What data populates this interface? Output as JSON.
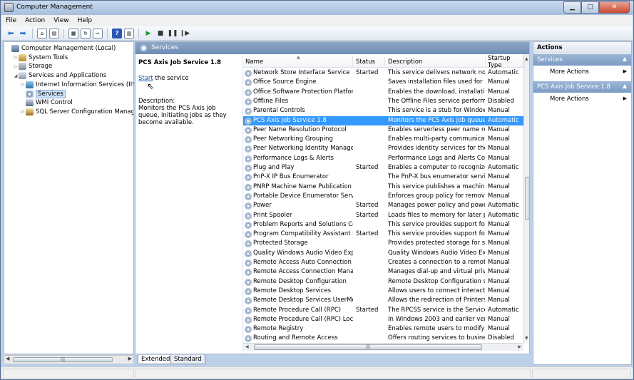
{
  "window": {
    "title": "Computer Management"
  },
  "menu": [
    "File",
    "Action",
    "View",
    "Help"
  ],
  "tree": [
    {
      "label": "Computer Management (Local)",
      "icon": "computer-icon",
      "level": 0,
      "expander": ""
    },
    {
      "label": "System Tools",
      "icon": "tools-icon",
      "level": 1,
      "expander": "▷"
    },
    {
      "label": "Storage",
      "icon": "storage-icon",
      "level": 1,
      "expander": "▷"
    },
    {
      "label": "Services and Applications",
      "icon": "apps-icon",
      "level": 1,
      "expander": "◢"
    },
    {
      "label": "Internet Information Services (IIS) Ma",
      "icon": "iis-icon",
      "level": 2,
      "expander": "▷"
    },
    {
      "label": "Services",
      "icon": "gear-icon",
      "level": 2,
      "expander": "",
      "selected": true
    },
    {
      "label": "WMI Control",
      "icon": "wmi-icon",
      "level": 2,
      "expander": ""
    },
    {
      "label": "SQL Server Configuration Manager",
      "icon": "sql-icon",
      "level": 2,
      "expander": "▷"
    }
  ],
  "services_panel": {
    "header": "Services",
    "selected_title": "PCS Axis Job Service 1.8",
    "start_link": "Start",
    "start_suffix": " the service",
    "description_label": "Description:",
    "description": "Monitors the PCS Axis job queue, initiating jobs as they become available."
  },
  "columns": {
    "name": "Name",
    "status": "Status",
    "description": "Description",
    "startup": "Startup Type"
  },
  "rows": [
    {
      "name": "Network Store Interface Service",
      "status": "Started",
      "description": "This service delivers network notif...",
      "startup": "Automatic"
    },
    {
      "name": "Office  Source Engine",
      "status": "",
      "description": "Saves installation files used for up...",
      "startup": "Manual"
    },
    {
      "name": "Office Software Protection Platform",
      "status": "",
      "description": "Enables the download, installatio...",
      "startup": "Manual"
    },
    {
      "name": "Offline Files",
      "status": "",
      "description": "The Offline Files service performs ...",
      "startup": "Disabled"
    },
    {
      "name": "Parental Controls",
      "status": "",
      "description": "This service is a stub for Windows...",
      "startup": "Manual"
    },
    {
      "name": "PCS Axis Job Service 1.8",
      "status": "",
      "description": "Monitors the PCS Axis job queue, ...",
      "startup": "Automatic",
      "selected": true
    },
    {
      "name": "Peer Name Resolution Protocol",
      "status": "",
      "description": "Enables serverless peer name reso...",
      "startup": "Manual"
    },
    {
      "name": "Peer Networking Grouping",
      "status": "",
      "description": "Enables multi-party communicati...",
      "startup": "Manual"
    },
    {
      "name": "Peer Networking Identity Manager",
      "status": "",
      "description": "Provides identity services for the ...",
      "startup": "Manual"
    },
    {
      "name": "Performance Logs & Alerts",
      "status": "",
      "description": "Performance Logs and Alerts Coll...",
      "startup": "Manual"
    },
    {
      "name": "Plug and Play",
      "status": "Started",
      "description": "Enables a computer to recognize ...",
      "startup": "Automatic"
    },
    {
      "name": "PnP-X IP Bus Enumerator",
      "status": "",
      "description": "The PnP-X bus enumerator servic...",
      "startup": "Manual"
    },
    {
      "name": "PNRP Machine Name Publication S...",
      "status": "",
      "description": "This service publishes a machine ...",
      "startup": "Manual"
    },
    {
      "name": "Portable Device Enumerator Service",
      "status": "",
      "description": "Enforces group policy for remova...",
      "startup": "Manual"
    },
    {
      "name": "Power",
      "status": "Started",
      "description": "Manages power policy and power...",
      "startup": "Automatic"
    },
    {
      "name": "Print Spooler",
      "status": "Started",
      "description": "Loads files to memory for later pri...",
      "startup": "Automatic"
    },
    {
      "name": "Problem Reports and Solutions Con...",
      "status": "",
      "description": "This service provides support for ...",
      "startup": "Manual"
    },
    {
      "name": "Program Compatibility Assistant Ser...",
      "status": "Started",
      "description": "This service provides support for t...",
      "startup": "Manual"
    },
    {
      "name": "Protected Storage",
      "status": "",
      "description": "Provides protected storage for se...",
      "startup": "Manual"
    },
    {
      "name": "Quality Windows Audio Video Exper...",
      "status": "",
      "description": "Quality Windows Audio Video Exp...",
      "startup": "Manual"
    },
    {
      "name": "Remote Access Auto Connection M...",
      "status": "",
      "description": "Creates a connection to a remote ...",
      "startup": "Manual"
    },
    {
      "name": "Remote Access Connection Manager",
      "status": "",
      "description": "Manages dial-up and virtual priva...",
      "startup": "Manual"
    },
    {
      "name": "Remote Desktop Configuration",
      "status": "",
      "description": "Remote Desktop Configuration se...",
      "startup": "Manual"
    },
    {
      "name": "Remote Desktop Services",
      "status": "",
      "description": "Allows users to connect interactiv...",
      "startup": "Manual"
    },
    {
      "name": "Remote Desktop Services UserMode...",
      "status": "",
      "description": "Allows the redirection of Printers/...",
      "startup": "Manual"
    },
    {
      "name": "Remote Procedure Call (RPC)",
      "status": "Started",
      "description": "The RPCSS service is the Service C...",
      "startup": "Automatic"
    },
    {
      "name": "Remote Procedure Call (RPC) Locator",
      "status": "",
      "description": "In Windows 2003 and earlier versi...",
      "startup": "Manual"
    },
    {
      "name": "Remote Registry",
      "status": "",
      "description": "Enables remote users to modify re...",
      "startup": "Manual"
    },
    {
      "name": "Routing and Remote Access",
      "status": "",
      "description": "Offers routing services to busines...",
      "startup": "Disabled"
    }
  ],
  "tabs": {
    "extended": "Extended",
    "standard": "Standard"
  },
  "actions": {
    "header": "Actions",
    "section1": "Services",
    "section1_item": "More Actions",
    "section2": "PCS Axis Job Service 1.8",
    "section2_item": "More Actions"
  },
  "colors": {
    "selection": "#3399ff",
    "section_header": "#7c9cc4",
    "link": "#1a4fa8"
  }
}
